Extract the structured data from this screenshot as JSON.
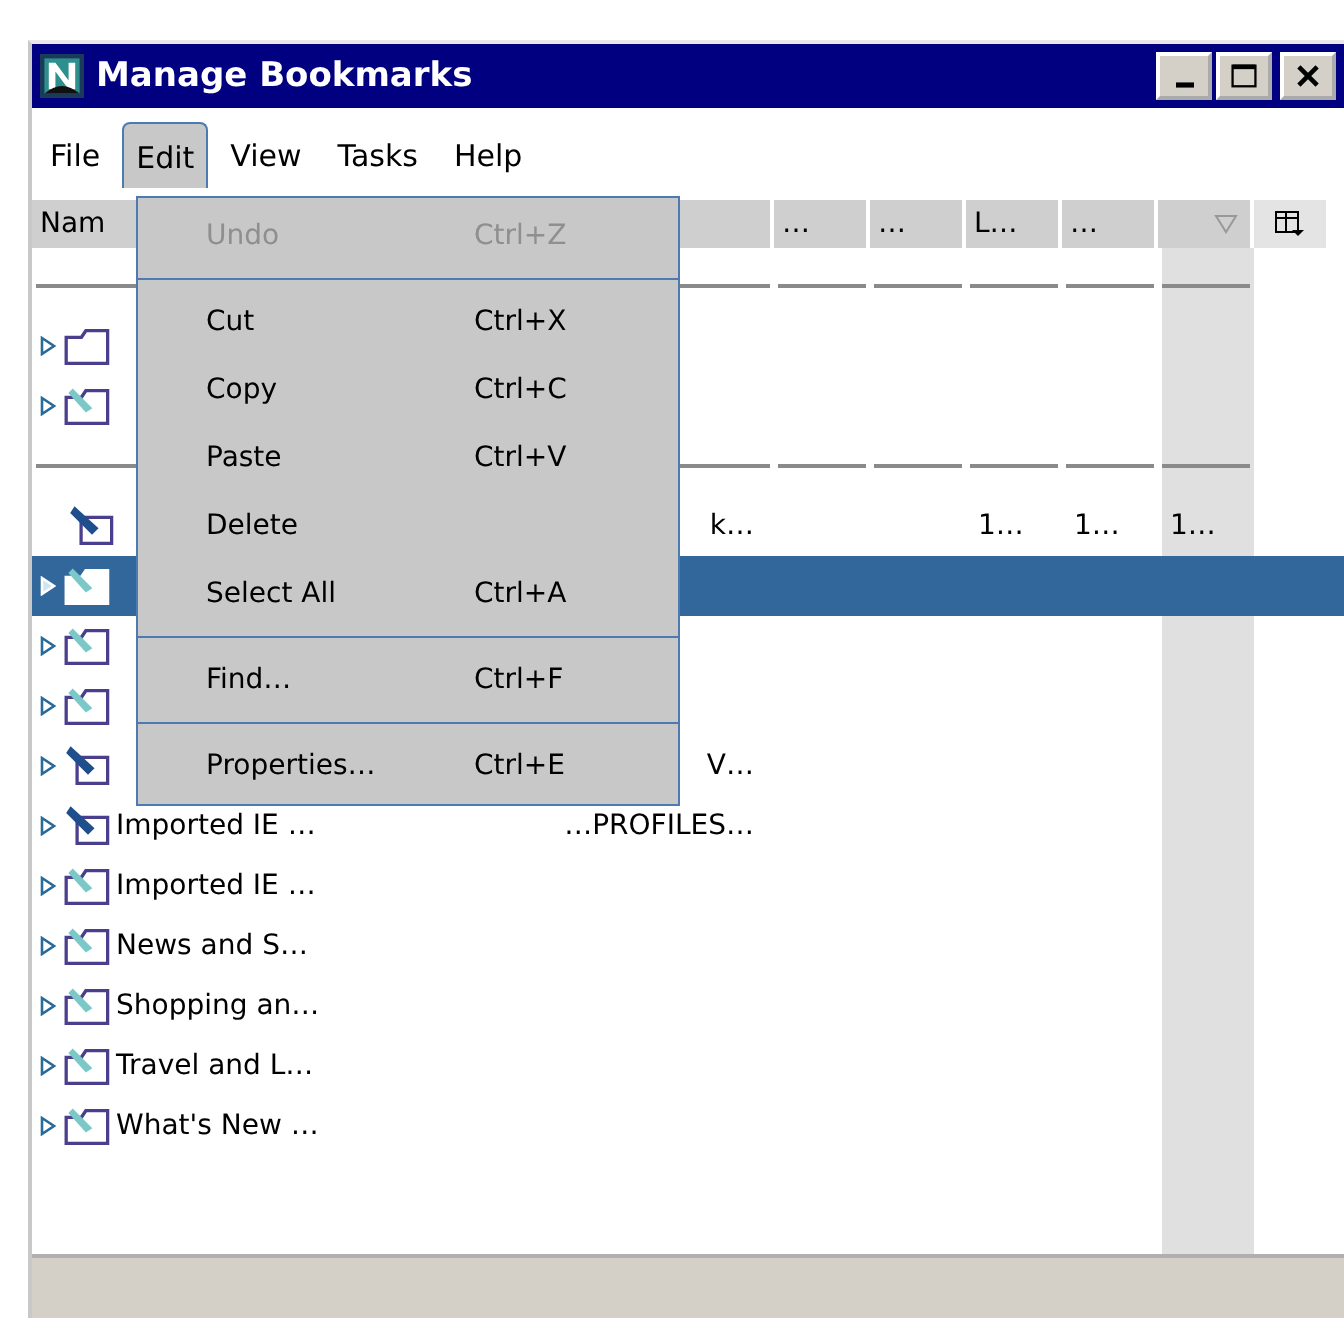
{
  "window": {
    "title": "Manage Bookmarks"
  },
  "menu_bar": [
    {
      "label": "File",
      "selected": false
    },
    {
      "label": "Edit",
      "selected": true
    },
    {
      "label": "View",
      "selected": false
    },
    {
      "label": "Tasks",
      "selected": false
    },
    {
      "label": "Help",
      "selected": false
    }
  ],
  "columns": [
    {
      "label": "Nam",
      "sorted": false
    },
    {
      "sorted": false
    },
    {
      "label": "…",
      "sorted": false
    },
    {
      "label": "…",
      "sorted": false
    },
    {
      "label": "L…",
      "sorted": false
    },
    {
      "label": "…",
      "sorted": false
    },
    {
      "sorted": true
    }
  ],
  "rows": [
    {
      "kind": "separator"
    },
    {
      "kind": "folder",
      "expanded": false,
      "selected": false
    },
    {
      "kind": "bookmark_folder",
      "expanded": false,
      "selected": false
    },
    {
      "kind": "separator"
    },
    {
      "kind": "bookmark",
      "selected": false,
      "location": "k…",
      "column_5": "1…",
      "column_6": "1…",
      "column_7": "1…"
    },
    {
      "kind": "bookmark_folder",
      "expanded": false,
      "selected": true
    },
    {
      "kind": "bookmark_folder",
      "expanded": false,
      "selected": false
    },
    {
      "kind": "bookmark_folder",
      "expanded": false,
      "selected": false
    },
    {
      "kind": "toolbar_folder",
      "expanded": false,
      "selected": false,
      "location": "V…"
    },
    {
      "kind": "toolbar_folder",
      "expanded": false,
      "selected": false,
      "name": "Imported IE …",
      "location": "…PROFILES…"
    },
    {
      "kind": "bookmark_folder",
      "expanded": false,
      "selected": false,
      "name": "Imported IE …"
    },
    {
      "kind": "bookmark_folder",
      "expanded": false,
      "selected": false,
      "name": "News and S…"
    },
    {
      "kind": "bookmark_folder",
      "expanded": false,
      "selected": false,
      "name": "Shopping an…"
    },
    {
      "kind": "bookmark_folder",
      "expanded": false,
      "selected": false,
      "name": "Travel and L…"
    },
    {
      "kind": "bookmark_folder",
      "expanded": false,
      "selected": false,
      "name": "What's New …"
    }
  ],
  "edit_menu": [
    {
      "kind": "item",
      "label": "Undo",
      "shortcut": "Ctrl+Z",
      "disabled": true
    },
    {
      "kind": "separator"
    },
    {
      "kind": "item",
      "label": "Cut",
      "shortcut": "Ctrl+X",
      "disabled": false
    },
    {
      "kind": "item",
      "label": "Copy",
      "shortcut": "Ctrl+C",
      "disabled": false
    },
    {
      "kind": "item",
      "label": "Paste",
      "shortcut": "Ctrl+V",
      "disabled": false
    },
    {
      "kind": "item",
      "label": "Delete",
      "disabled": false
    },
    {
      "kind": "item",
      "label": "Select All",
      "shortcut": "Ctrl+A",
      "disabled": false
    },
    {
      "kind": "separator"
    },
    {
      "kind": "item",
      "label": "Find…",
      "shortcut": "Ctrl+F",
      "disabled": false
    },
    {
      "kind": "separator"
    },
    {
      "kind": "item",
      "label": "Properties…",
      "shortcut": "Ctrl+E",
      "disabled": false
    }
  ]
}
